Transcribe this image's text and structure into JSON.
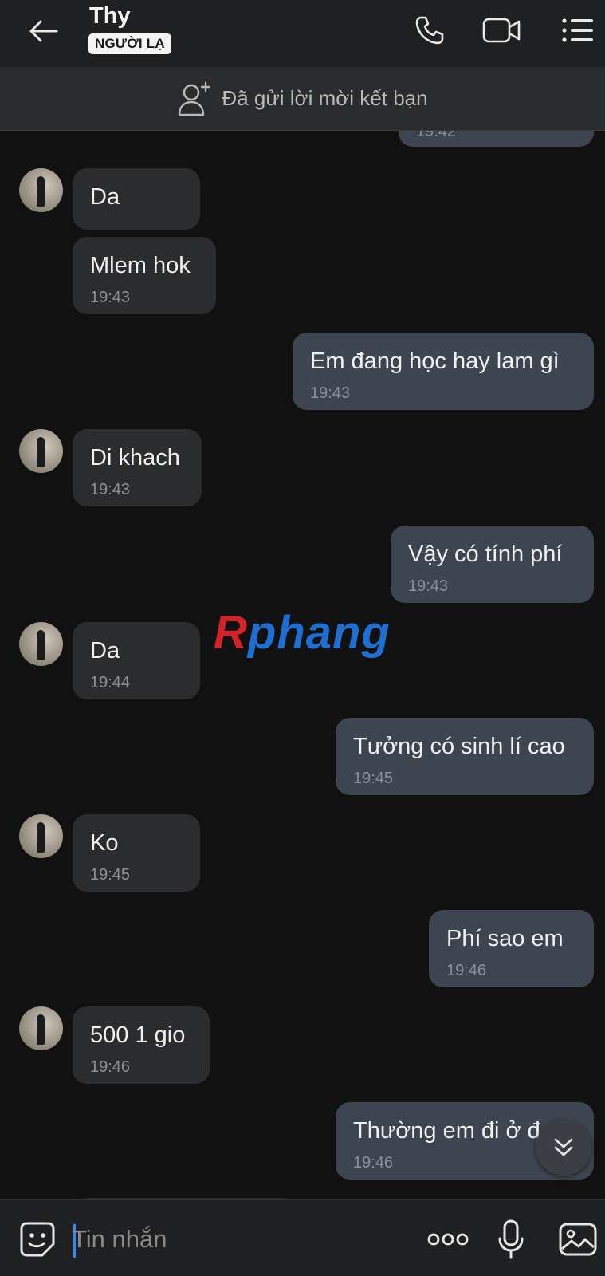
{
  "header": {
    "contact_name": "Thy",
    "badge": "NGƯỜI LẠ"
  },
  "friend_request": {
    "text": "Đã gửi lời mời kết bạn"
  },
  "messages": [
    {
      "dir": "out",
      "text": "",
      "time": "19:42"
    },
    {
      "dir": "in",
      "text": "Da",
      "time": ""
    },
    {
      "dir": "in",
      "text": "Mlem hok",
      "time": "19:43"
    },
    {
      "dir": "out",
      "text": "Em đang học hay lam gì",
      "time": "19:43"
    },
    {
      "dir": "in",
      "text": "Di khach",
      "time": "19:43"
    },
    {
      "dir": "out",
      "text": "Vậy có tính phí",
      "time": "19:43"
    },
    {
      "dir": "in",
      "text": "Da",
      "time": "19:44"
    },
    {
      "dir": "out",
      "text": "Tưởng có sinh lí cao",
      "time": "19:45"
    },
    {
      "dir": "in",
      "text": "Ko",
      "time": "19:45"
    },
    {
      "dir": "out",
      "text": "Phí sao em",
      "time": "19:46"
    },
    {
      "dir": "in",
      "text": "500 1 gio",
      "time": "19:46"
    },
    {
      "dir": "out",
      "text": "Thường em đi ở đ",
      "time": "19:46"
    }
  ],
  "watermark": {
    "first": "R",
    "rest": "phang"
  },
  "composer": {
    "placeholder": "Tin nhắn"
  },
  "colors": {
    "background": "#111112",
    "incoming_bubble": "#2b2c2e",
    "outgoing_bubble": "#3d4550",
    "accent": "#2a8cff"
  }
}
